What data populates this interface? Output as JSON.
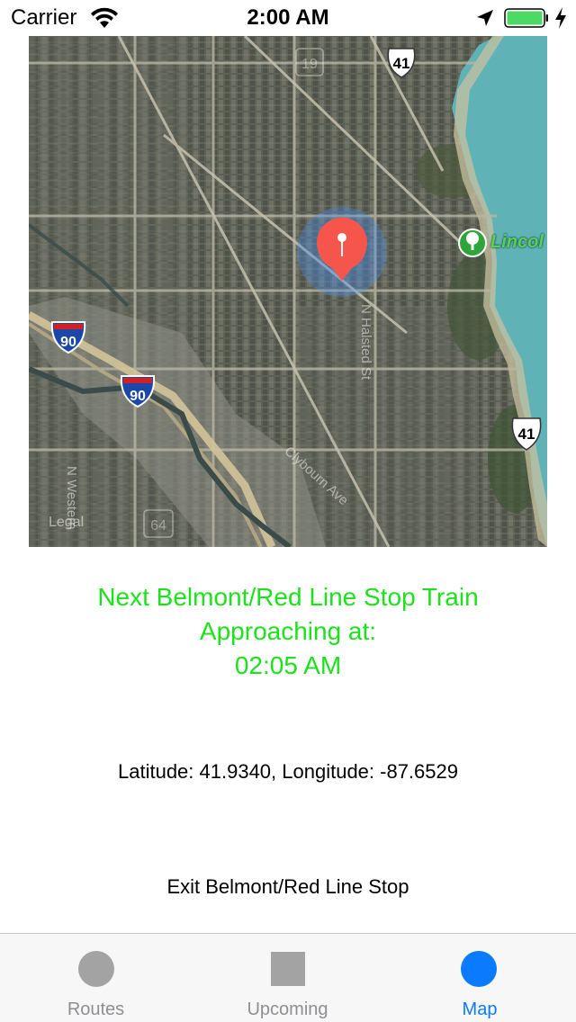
{
  "status_bar": {
    "carrier": "Carrier",
    "time": "2:00 AM",
    "battery_color": "#4cd964"
  },
  "map": {
    "legal_label": "Legal",
    "poi_label": "Lincol",
    "street_labels": [
      "N Halsted St",
      "Clybourn Ave",
      "N Western"
    ],
    "highway_shields": [
      "41",
      "41",
      "90",
      "90"
    ],
    "faded_shields": [
      "19",
      "64"
    ],
    "pin_color": "#f5554a",
    "water_color": "#5fb3b7"
  },
  "next_train": {
    "line1": "Next Belmont/Red Line Stop Train",
    "line2": "Approaching at:",
    "time": "02:05 AM",
    "color": "#1ee11e"
  },
  "location": {
    "coordinates_text": "Latitude: 41.9340, Longitude: -87.6529"
  },
  "exit_button": {
    "label": "Exit Belmont/Red Line Stop"
  },
  "tab_bar": {
    "tabs": [
      {
        "label": "Routes",
        "icon": "circle-icon",
        "active": false
      },
      {
        "label": "Upcoming",
        "icon": "square-icon",
        "active": false
      },
      {
        "label": "Map",
        "icon": "circle-icon",
        "active": true
      }
    ],
    "active_color": "#0a7aff",
    "inactive_color": "#8e8e93"
  }
}
